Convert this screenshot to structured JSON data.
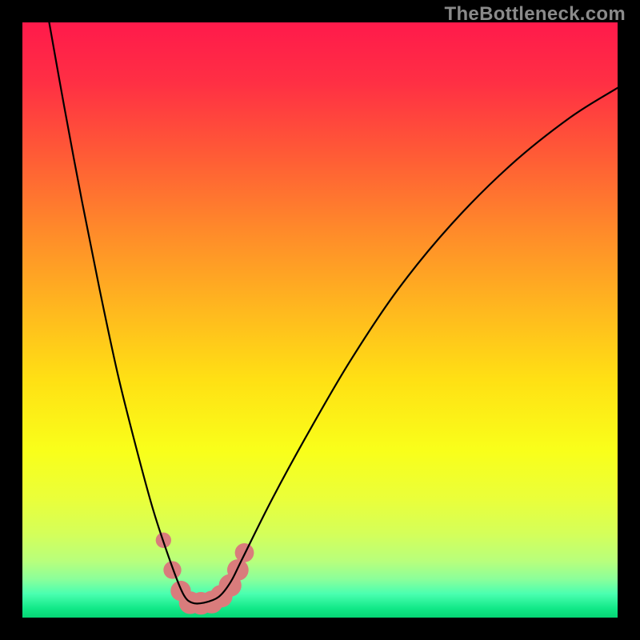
{
  "watermark": {
    "text": "TheBottleneck.com"
  },
  "gradient": {
    "stops": [
      {
        "offset": 0.0,
        "color": "#ff1a4b"
      },
      {
        "offset": 0.1,
        "color": "#ff2f44"
      },
      {
        "offset": 0.22,
        "color": "#ff5a36"
      },
      {
        "offset": 0.35,
        "color": "#ff8a2a"
      },
      {
        "offset": 0.48,
        "color": "#ffb71f"
      },
      {
        "offset": 0.6,
        "color": "#ffe014"
      },
      {
        "offset": 0.72,
        "color": "#f9ff1a"
      },
      {
        "offset": 0.8,
        "color": "#eaff3a"
      },
      {
        "offset": 0.86,
        "color": "#d4ff5a"
      },
      {
        "offset": 0.905,
        "color": "#b8ff7c"
      },
      {
        "offset": 0.935,
        "color": "#8cff9a"
      },
      {
        "offset": 0.96,
        "color": "#4affb0"
      },
      {
        "offset": 0.985,
        "color": "#11e887"
      },
      {
        "offset": 1.0,
        "color": "#05d574"
      }
    ]
  },
  "chart_data": {
    "type": "line",
    "title": "",
    "xlabel": "",
    "ylabel": "",
    "xlim": [
      0,
      100
    ],
    "ylim": [
      0,
      100
    ],
    "series": [
      {
        "name": "bottleneck-curve",
        "x": [
          4.5,
          7,
          10,
          13,
          16,
          19,
          22,
          25,
          27,
          28.5,
          30.5,
          33,
          35,
          37,
          42,
          48,
          55,
          63,
          72,
          82,
          92,
          100
        ],
        "y": [
          100,
          86,
          70,
          55,
          41,
          29,
          18,
          9,
          4,
          2.5,
          2.5,
          3.5,
          6,
          10,
          20,
          31,
          43,
          55,
          66,
          76,
          84,
          89
        ]
      }
    ],
    "highlight": {
      "name": "optimal-band",
      "color": "#d97c7c",
      "points": [
        {
          "x": 23.7,
          "y": 13.0,
          "r": 1.3
        },
        {
          "x": 25.2,
          "y": 8.0,
          "r": 1.5
        },
        {
          "x": 26.6,
          "y": 4.5,
          "r": 1.7
        },
        {
          "x": 28.2,
          "y": 2.5,
          "r": 1.9
        },
        {
          "x": 30.0,
          "y": 2.4,
          "r": 1.9
        },
        {
          "x": 31.8,
          "y": 2.6,
          "r": 1.9
        },
        {
          "x": 33.4,
          "y": 3.6,
          "r": 1.9
        },
        {
          "x": 34.9,
          "y": 5.4,
          "r": 1.9
        },
        {
          "x": 36.2,
          "y": 8.0,
          "r": 1.8
        },
        {
          "x": 37.3,
          "y": 10.9,
          "r": 1.6
        }
      ]
    }
  }
}
